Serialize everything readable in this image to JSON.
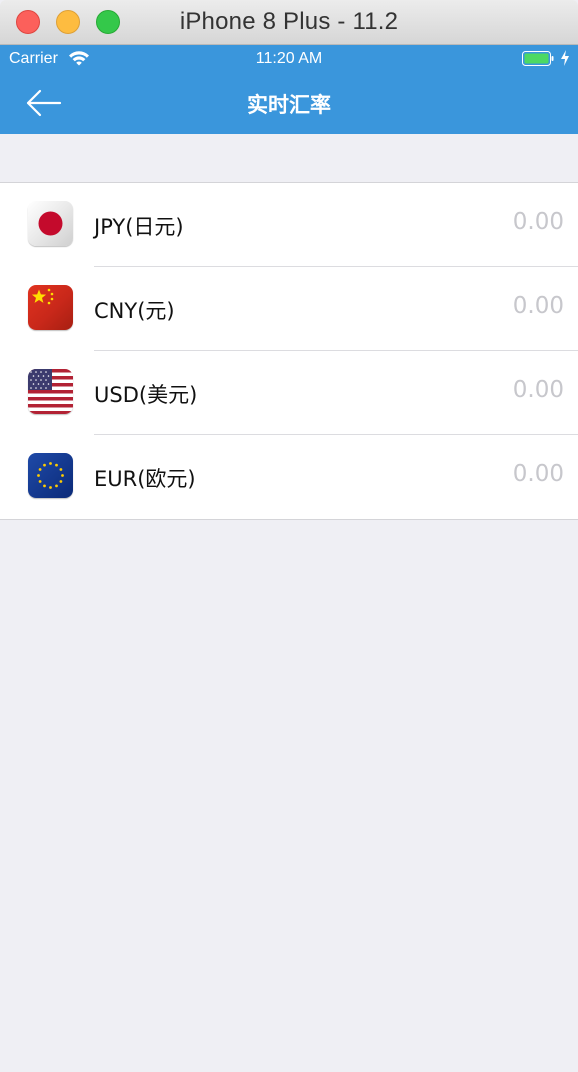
{
  "window": {
    "title": "iPhone 8 Plus - 11.2"
  },
  "status_bar": {
    "carrier": "Carrier",
    "time": "11:20 AM"
  },
  "nav": {
    "title": "实时汇率",
    "back_icon": "arrow-left-icon"
  },
  "currencies": [
    {
      "code": "JPY",
      "label": "JPY(日元)",
      "value": "0.00",
      "flag_icon": "japan-flag-icon"
    },
    {
      "code": "CNY",
      "label": "CNY(元)",
      "value": "0.00",
      "flag_icon": "china-flag-icon"
    },
    {
      "code": "USD",
      "label": "USD(美元)",
      "value": "0.00",
      "flag_icon": "usa-flag-icon"
    },
    {
      "code": "EUR",
      "label": "EUR(欧元)",
      "value": "0.00",
      "flag_icon": "eu-flag-icon"
    }
  ],
  "colors": {
    "nav_bar": "#3a96dc",
    "background": "#efeff4",
    "rate_value": "#c7c7cc"
  }
}
